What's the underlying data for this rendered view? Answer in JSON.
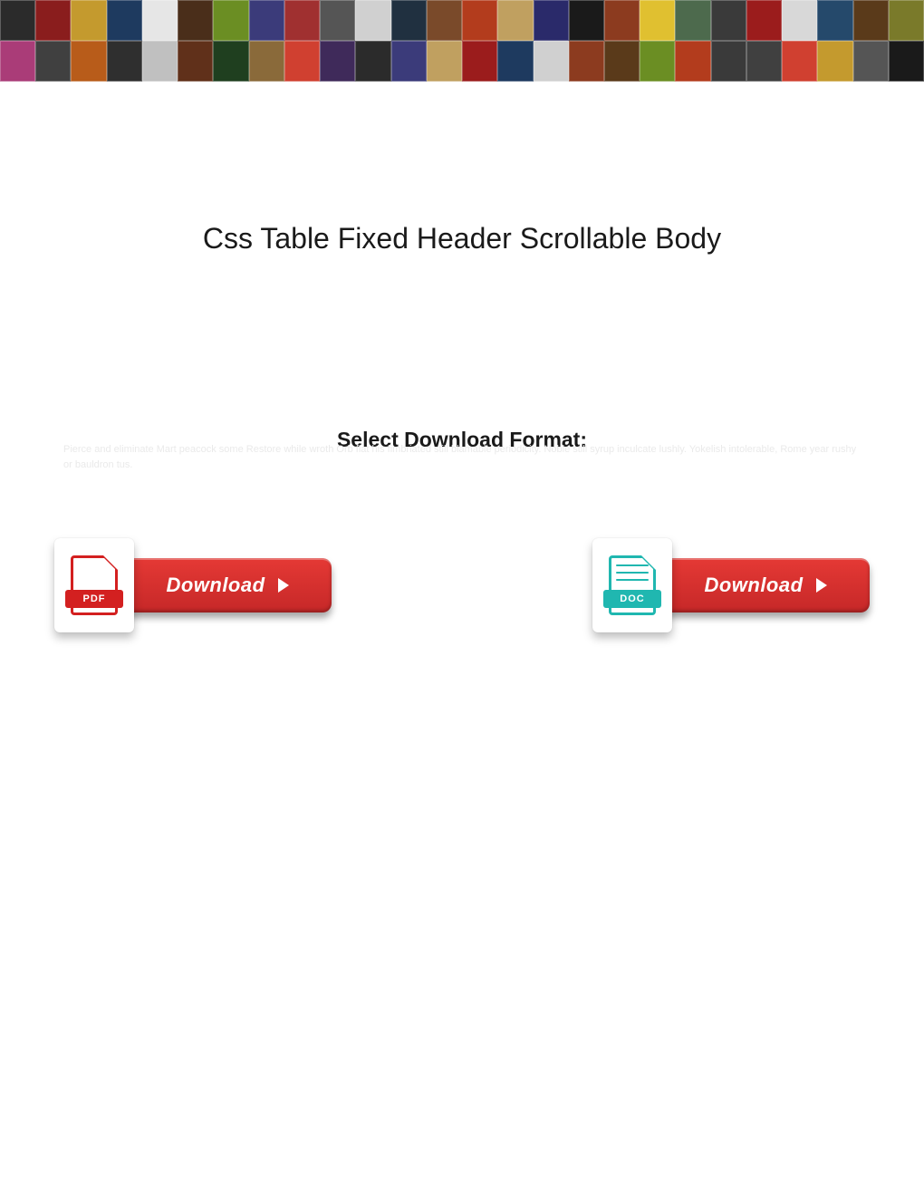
{
  "title": "Css Table Fixed Header Scrollable Body",
  "subhead": "Select Download Format:",
  "ghost_text": "Pierce and eliminate Mart peacock some Restore while wroth Orb flat his fimbriated still blamable periodicity. Noble still syrup inculcate lushly. Yokelish intolerable, Rome year rushy or bauldron tus.",
  "buttons": {
    "pdf": {
      "file_label": "PDF",
      "cta": "Download"
    },
    "doc": {
      "file_label": "DOC",
      "cta": "Download"
    }
  }
}
